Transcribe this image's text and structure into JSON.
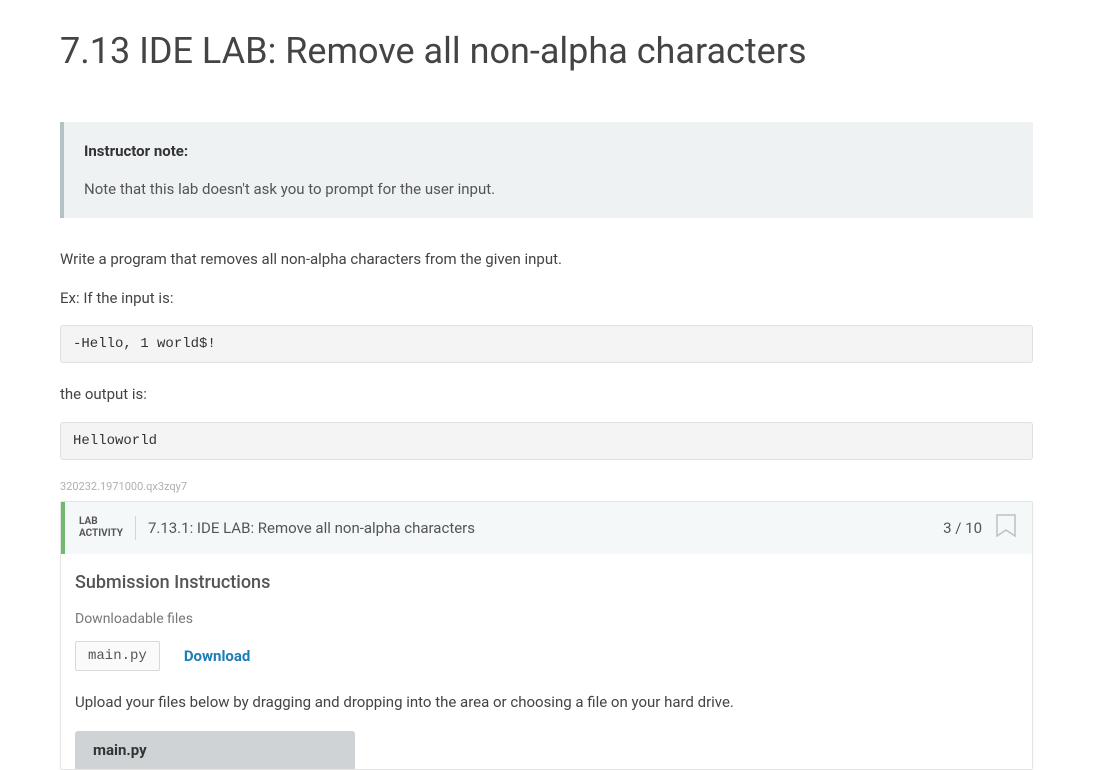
{
  "title": "7.13 IDE LAB: Remove all non-alpha characters",
  "instructor_note": {
    "heading": "Instructor note:",
    "body": "Note that this lab doesn't ask you to prompt for the user input."
  },
  "description": "Write a program that removes all non-alpha characters from the given input.",
  "example_label": "Ex: If the input is:",
  "example_input": "-Hello, 1 world$!",
  "output_label": "the output is:",
  "example_output": "Helloworld",
  "ref_id": "320232.1971000.qx3zqy7",
  "lab": {
    "badge_line1": "LAB",
    "badge_line2": "ACTIVITY",
    "title": "7.13.1: IDE LAB: Remove all non-alpha characters",
    "score": "3 / 10",
    "submission_heading": "Submission Instructions",
    "downloadable_label": "Downloadable files",
    "file_name": "main.py",
    "download_label": "Download",
    "upload_instruction": "Upload your files below by dragging and dropping into the area or choosing a file on your hard drive.",
    "upload_tab": "main.py"
  }
}
